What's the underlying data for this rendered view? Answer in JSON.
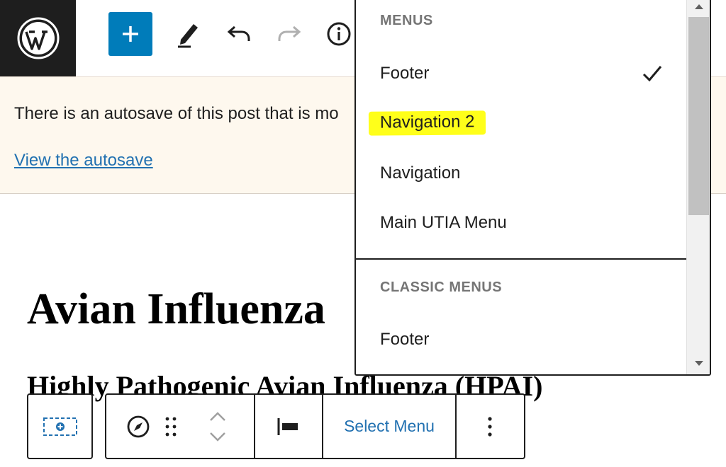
{
  "topbar": {
    "logo": "wordpress-logo",
    "add_icon": "plus-icon",
    "tools_icon": "pencil-icon",
    "undo_icon": "undo-icon",
    "redo_icon": "redo-icon",
    "info_icon": "info-icon",
    "accent_color": "#007cba"
  },
  "notice": {
    "text": "There is an autosave of this post that is mo",
    "link": "View the autosave",
    "background": "#fef8ee"
  },
  "content": {
    "title": "Avian Influenza",
    "subtitle": "Highly Pathogenic Avian Influenza (HPAI)"
  },
  "block_toolbar": {
    "block_icon": "navigation-block-icon",
    "compass_icon": "compass-icon",
    "drag_icon": "drag-handle-icon",
    "move_up_icon": "chevron-up-icon",
    "move_down_icon": "chevron-down-icon",
    "justify_icon": "justify-left-icon",
    "select_menu_label": "Select Menu",
    "more_icon": "more-vertical-icon"
  },
  "dropdown": {
    "menus_heading": "MENUS",
    "menus": [
      {
        "label": "Footer",
        "selected": true
      },
      {
        "label": "Navigation 2",
        "selected": false,
        "highlighted": true
      },
      {
        "label": "Navigation",
        "selected": false
      },
      {
        "label": "Main UTIA Menu",
        "selected": false
      }
    ],
    "classic_heading": "CLASSIC MENUS",
    "classic_menus": [
      {
        "label": "Footer"
      }
    ],
    "highlight_color": "#ffff1a"
  }
}
